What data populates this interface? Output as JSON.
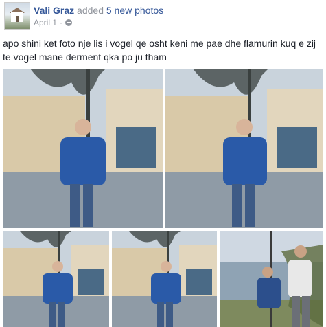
{
  "post": {
    "author": "Vali Graz",
    "action_prefix": "added",
    "action_link": "5 new photos",
    "date": "April 1",
    "separator": "·",
    "privacy_icon": "globe-icon",
    "text": "apo shini ket foto nje lis i vogel qe osht keni me pae dhe flamurin kuq e zij te vogel mane derment qka po ju tham"
  },
  "photos": [
    {
      "name": "photo-1",
      "scene": "man-in-blue-jacket-city-square"
    },
    {
      "name": "photo-2",
      "scene": "man-in-blue-jacket-city-square"
    },
    {
      "name": "photo-3",
      "scene": "man-in-blue-jacket-city-square"
    },
    {
      "name": "photo-4",
      "scene": "man-in-blue-jacket-city-square"
    },
    {
      "name": "photo-5",
      "scene": "two-men-by-lake"
    }
  ],
  "colors": {
    "link": "#365899",
    "meta": "#90949c",
    "text": "#1d2129"
  }
}
